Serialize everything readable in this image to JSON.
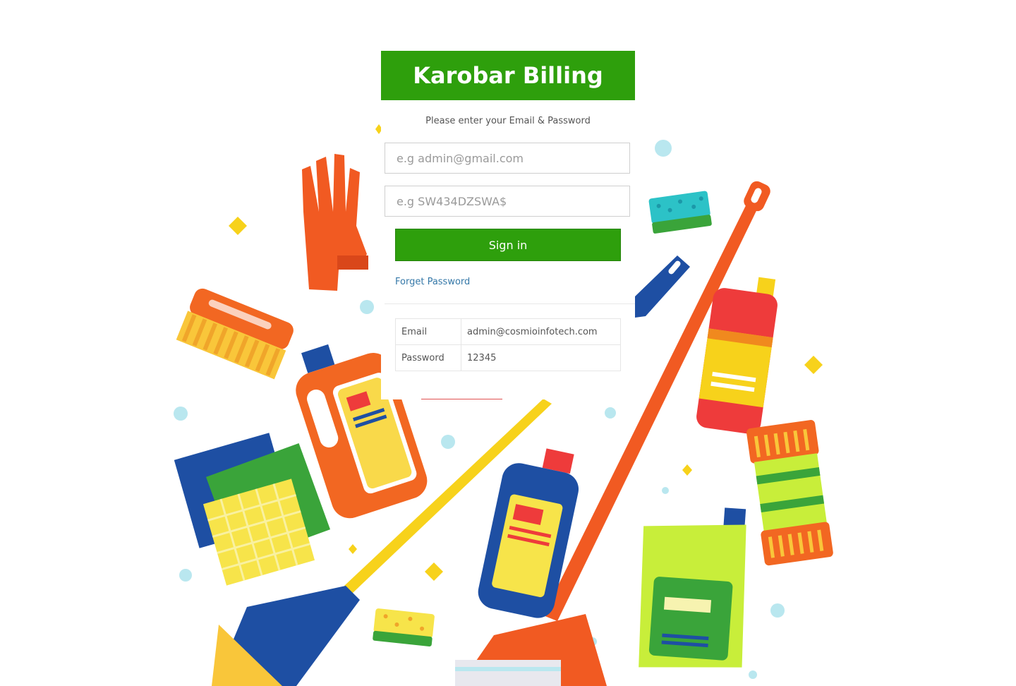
{
  "app": {
    "title": "Karobar Billing",
    "subtitle": "Please enter your Email & Password"
  },
  "form": {
    "email_placeholder": "e.g admin@gmail.com",
    "password_placeholder": "e.g SW434DZSWA$",
    "signin_label": "Sign in",
    "forget_label": "Forget Password"
  },
  "demo_credentials": [
    {
      "label": "Email",
      "value": "admin@cosmioinfotech.com"
    },
    {
      "label": "Password",
      "value": "12345"
    }
  ],
  "colors": {
    "brand_green": "#2e9f0c",
    "link_blue": "#3578a8"
  },
  "background": {
    "illustration": "cleaning-supplies-illustration",
    "items": [
      "rubber-glove-icon",
      "scrub-brush-icon",
      "sponge-icon",
      "spray-bottle-icon",
      "detergent-bottle-icon",
      "mop-icon",
      "broom-icon",
      "cleaning-cloth-icon",
      "bubble-icon",
      "sparkle-icon"
    ]
  }
}
